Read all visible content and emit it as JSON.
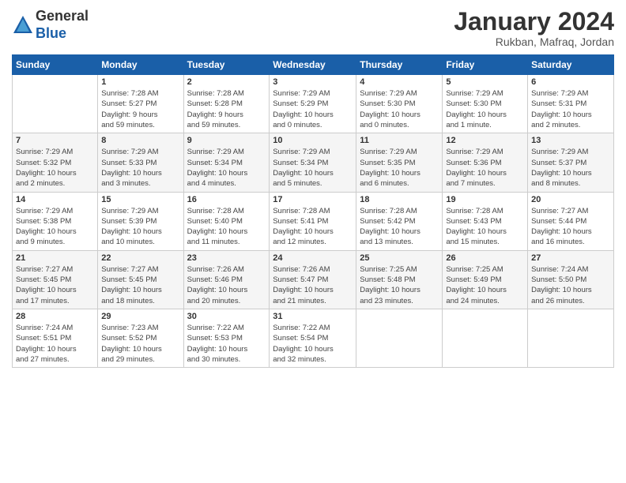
{
  "header": {
    "logo_line1": "General",
    "logo_line2": "Blue",
    "month": "January 2024",
    "location": "Rukban, Mafraq, Jordan"
  },
  "days_of_week": [
    "Sunday",
    "Monday",
    "Tuesday",
    "Wednesday",
    "Thursday",
    "Friday",
    "Saturday"
  ],
  "weeks": [
    [
      {
        "day": "",
        "info": ""
      },
      {
        "day": "1",
        "info": "Sunrise: 7:28 AM\nSunset: 5:27 PM\nDaylight: 9 hours\nand 59 minutes."
      },
      {
        "day": "2",
        "info": "Sunrise: 7:28 AM\nSunset: 5:28 PM\nDaylight: 9 hours\nand 59 minutes."
      },
      {
        "day": "3",
        "info": "Sunrise: 7:29 AM\nSunset: 5:29 PM\nDaylight: 10 hours\nand 0 minutes."
      },
      {
        "day": "4",
        "info": "Sunrise: 7:29 AM\nSunset: 5:30 PM\nDaylight: 10 hours\nand 0 minutes."
      },
      {
        "day": "5",
        "info": "Sunrise: 7:29 AM\nSunset: 5:30 PM\nDaylight: 10 hours\nand 1 minute."
      },
      {
        "day": "6",
        "info": "Sunrise: 7:29 AM\nSunset: 5:31 PM\nDaylight: 10 hours\nand 2 minutes."
      }
    ],
    [
      {
        "day": "7",
        "info": "Sunrise: 7:29 AM\nSunset: 5:32 PM\nDaylight: 10 hours\nand 2 minutes."
      },
      {
        "day": "8",
        "info": "Sunrise: 7:29 AM\nSunset: 5:33 PM\nDaylight: 10 hours\nand 3 minutes."
      },
      {
        "day": "9",
        "info": "Sunrise: 7:29 AM\nSunset: 5:34 PM\nDaylight: 10 hours\nand 4 minutes."
      },
      {
        "day": "10",
        "info": "Sunrise: 7:29 AM\nSunset: 5:34 PM\nDaylight: 10 hours\nand 5 minutes."
      },
      {
        "day": "11",
        "info": "Sunrise: 7:29 AM\nSunset: 5:35 PM\nDaylight: 10 hours\nand 6 minutes."
      },
      {
        "day": "12",
        "info": "Sunrise: 7:29 AM\nSunset: 5:36 PM\nDaylight: 10 hours\nand 7 minutes."
      },
      {
        "day": "13",
        "info": "Sunrise: 7:29 AM\nSunset: 5:37 PM\nDaylight: 10 hours\nand 8 minutes."
      }
    ],
    [
      {
        "day": "14",
        "info": "Sunrise: 7:29 AM\nSunset: 5:38 PM\nDaylight: 10 hours\nand 9 minutes."
      },
      {
        "day": "15",
        "info": "Sunrise: 7:29 AM\nSunset: 5:39 PM\nDaylight: 10 hours\nand 10 minutes."
      },
      {
        "day": "16",
        "info": "Sunrise: 7:28 AM\nSunset: 5:40 PM\nDaylight: 10 hours\nand 11 minutes."
      },
      {
        "day": "17",
        "info": "Sunrise: 7:28 AM\nSunset: 5:41 PM\nDaylight: 10 hours\nand 12 minutes."
      },
      {
        "day": "18",
        "info": "Sunrise: 7:28 AM\nSunset: 5:42 PM\nDaylight: 10 hours\nand 13 minutes."
      },
      {
        "day": "19",
        "info": "Sunrise: 7:28 AM\nSunset: 5:43 PM\nDaylight: 10 hours\nand 15 minutes."
      },
      {
        "day": "20",
        "info": "Sunrise: 7:27 AM\nSunset: 5:44 PM\nDaylight: 10 hours\nand 16 minutes."
      }
    ],
    [
      {
        "day": "21",
        "info": "Sunrise: 7:27 AM\nSunset: 5:45 PM\nDaylight: 10 hours\nand 17 minutes."
      },
      {
        "day": "22",
        "info": "Sunrise: 7:27 AM\nSunset: 5:45 PM\nDaylight: 10 hours\nand 18 minutes."
      },
      {
        "day": "23",
        "info": "Sunrise: 7:26 AM\nSunset: 5:46 PM\nDaylight: 10 hours\nand 20 minutes."
      },
      {
        "day": "24",
        "info": "Sunrise: 7:26 AM\nSunset: 5:47 PM\nDaylight: 10 hours\nand 21 minutes."
      },
      {
        "day": "25",
        "info": "Sunrise: 7:25 AM\nSunset: 5:48 PM\nDaylight: 10 hours\nand 23 minutes."
      },
      {
        "day": "26",
        "info": "Sunrise: 7:25 AM\nSunset: 5:49 PM\nDaylight: 10 hours\nand 24 minutes."
      },
      {
        "day": "27",
        "info": "Sunrise: 7:24 AM\nSunset: 5:50 PM\nDaylight: 10 hours\nand 26 minutes."
      }
    ],
    [
      {
        "day": "28",
        "info": "Sunrise: 7:24 AM\nSunset: 5:51 PM\nDaylight: 10 hours\nand 27 minutes."
      },
      {
        "day": "29",
        "info": "Sunrise: 7:23 AM\nSunset: 5:52 PM\nDaylight: 10 hours\nand 29 minutes."
      },
      {
        "day": "30",
        "info": "Sunrise: 7:22 AM\nSunset: 5:53 PM\nDaylight: 10 hours\nand 30 minutes."
      },
      {
        "day": "31",
        "info": "Sunrise: 7:22 AM\nSunset: 5:54 PM\nDaylight: 10 hours\nand 32 minutes."
      },
      {
        "day": "",
        "info": ""
      },
      {
        "day": "",
        "info": ""
      },
      {
        "day": "",
        "info": ""
      }
    ]
  ]
}
